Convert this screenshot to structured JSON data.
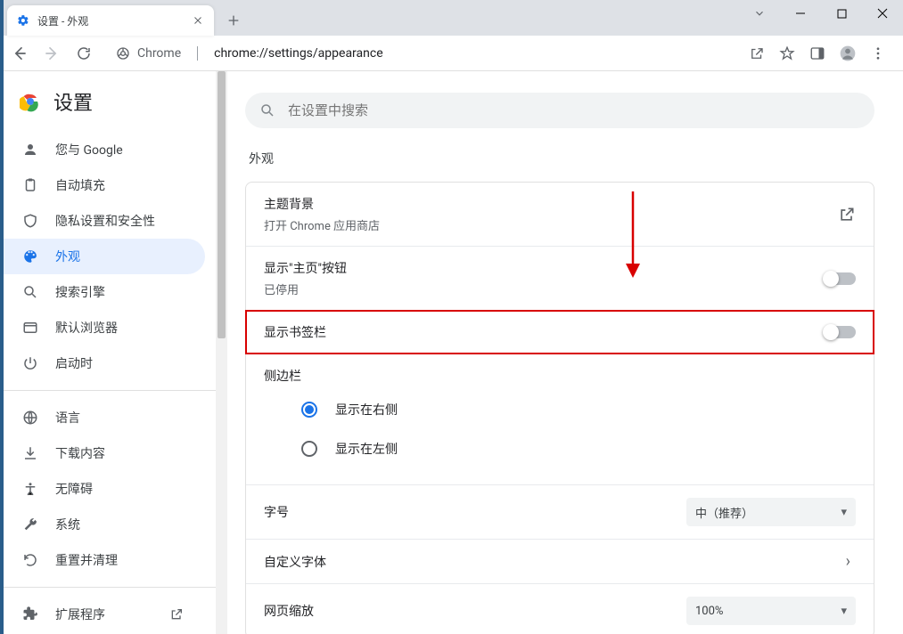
{
  "window": {
    "tab_title": "设置 - 外观"
  },
  "urlbar": {
    "origin_label": "Chrome",
    "url": "chrome://settings/appearance"
  },
  "sidebar": {
    "title": "设置",
    "items": [
      {
        "label": "您与 Google"
      },
      {
        "label": "自动填充"
      },
      {
        "label": "隐私设置和安全性"
      },
      {
        "label": "外观"
      },
      {
        "label": "搜索引擎"
      },
      {
        "label": "默认浏览器"
      },
      {
        "label": "启动时"
      },
      {
        "label": "语言"
      },
      {
        "label": "下载内容"
      },
      {
        "label": "无障碍"
      },
      {
        "label": "系统"
      },
      {
        "label": "重置并清理"
      },
      {
        "label": "扩展程序"
      }
    ]
  },
  "search": {
    "placeholder": "在设置中搜索"
  },
  "section": {
    "title": "外观"
  },
  "rows": {
    "theme_title": "主题背景",
    "theme_sub": "打开 Chrome 应用商店",
    "home_title": "显示\"主页\"按钮",
    "home_sub": "已停用",
    "bookmarks_title": "显示书签栏",
    "sidepanel_title": "侧边栏",
    "sidepanel_right": "显示在右侧",
    "sidepanel_left": "显示在左侧",
    "fontsize_title": "字号",
    "fontsize_value": "中（推荐）",
    "customfont_title": "自定义字体",
    "zoom_title": "网页缩放",
    "zoom_value": "100%"
  }
}
